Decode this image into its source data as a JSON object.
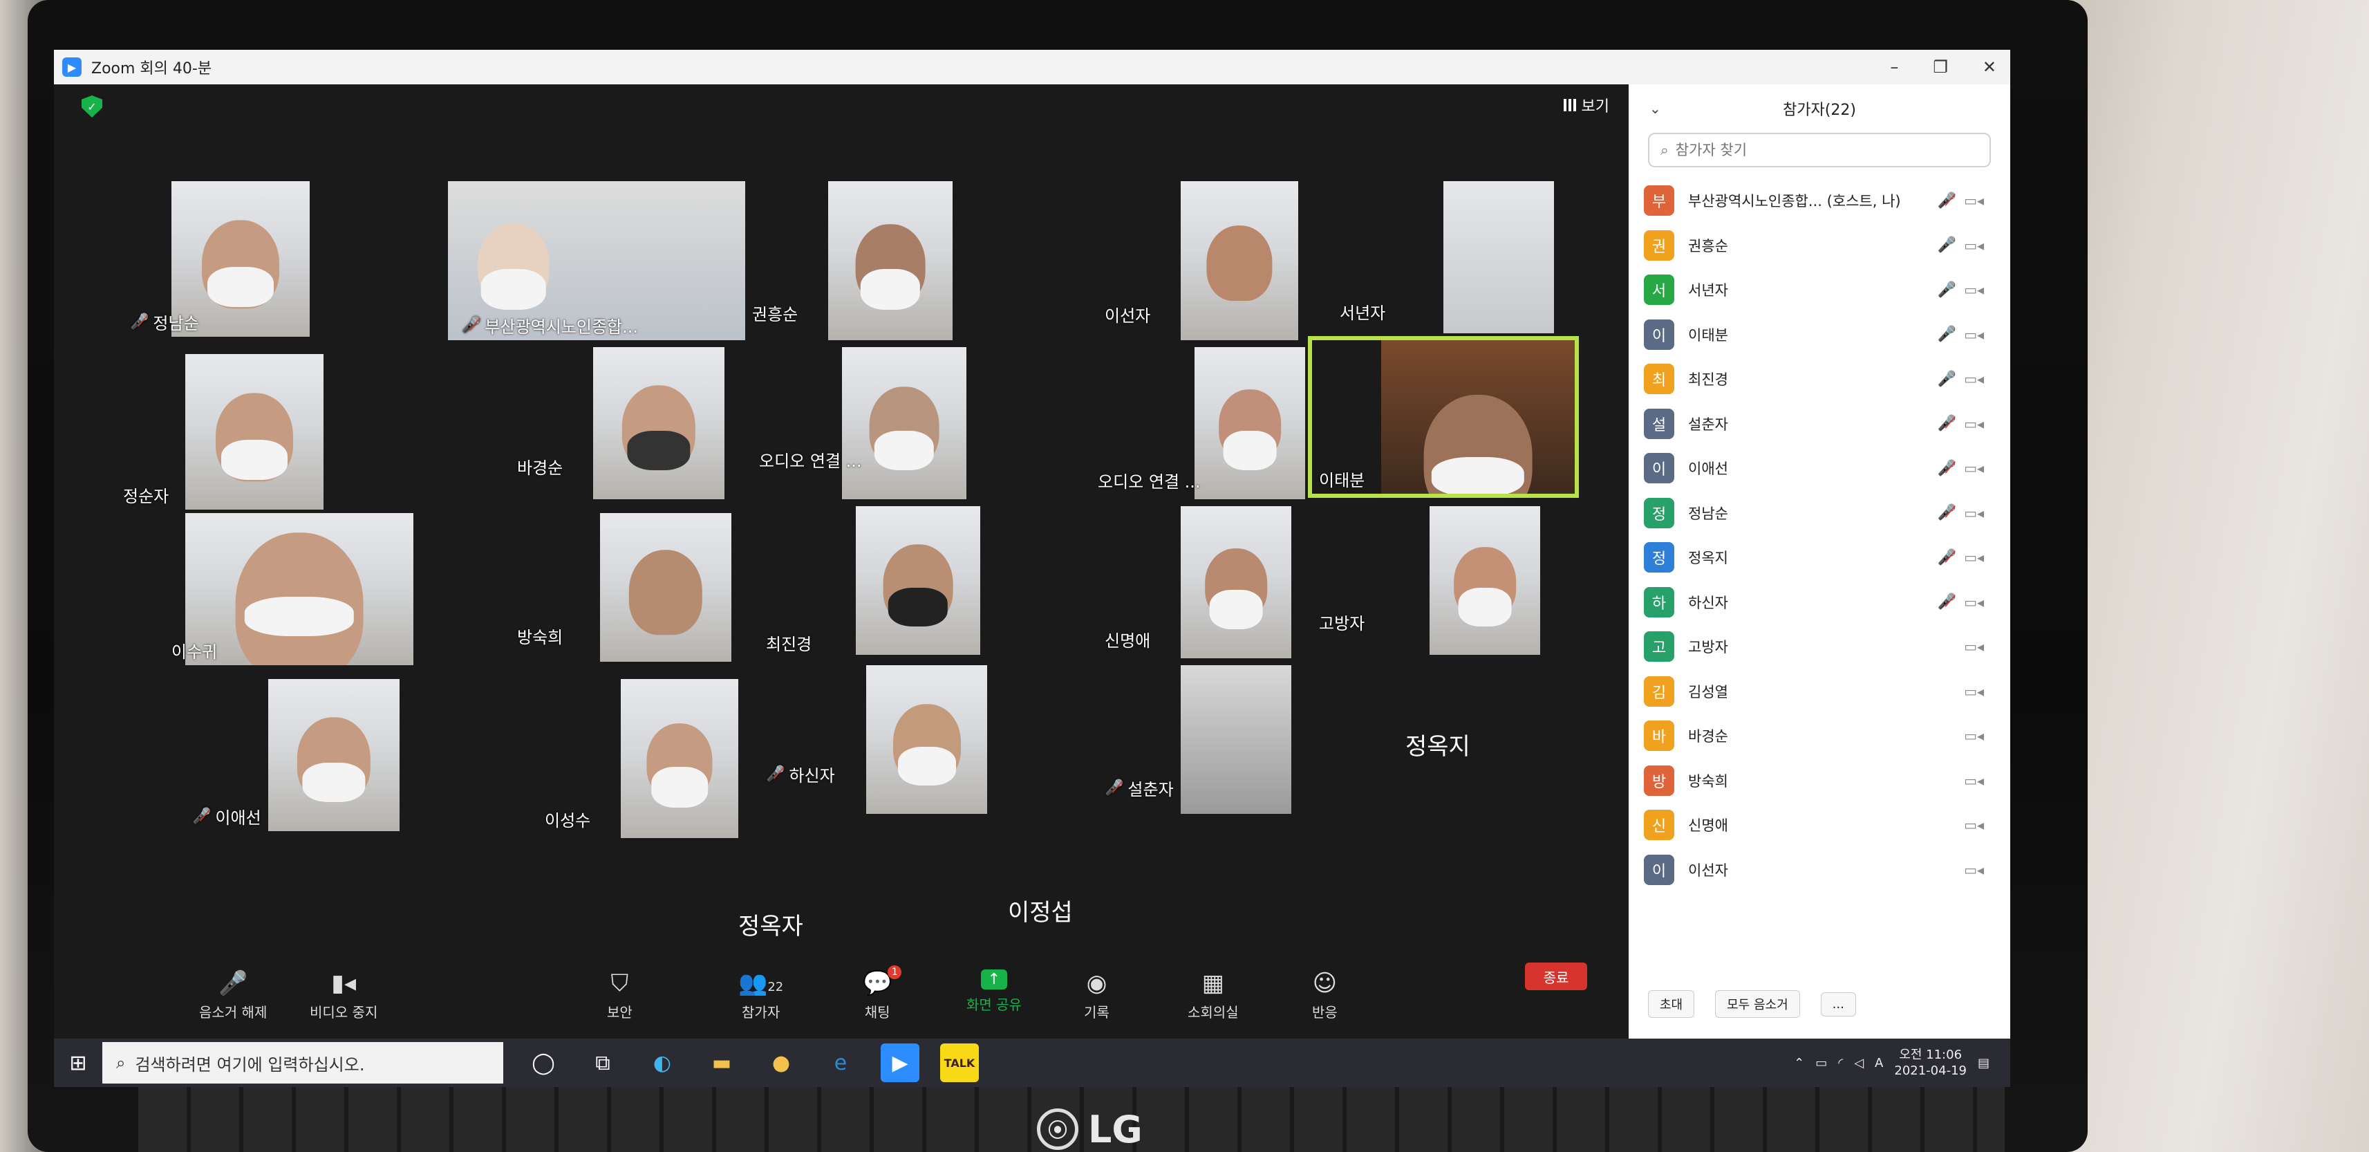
{
  "window": {
    "title": "Zoom 회의 40-분",
    "controls": [
      "–",
      "❐",
      "✕"
    ]
  },
  "meeting": {
    "view_label": "보기",
    "tiles": [
      {
        "name": "정남순",
        "muted": true
      },
      {
        "name": "부산광역시노인종합...",
        "muted": true
      },
      {
        "name": "권흥순",
        "muted": false
      },
      {
        "name": "이선자",
        "muted": false
      },
      {
        "name": "서년자",
        "muted": false
      },
      {
        "name": "정순자",
        "muted": false
      },
      {
        "name": "바경순",
        "muted": false
      },
      {
        "name": "오디오 연결 ...",
        "muted": false
      },
      {
        "name": "오디오 연결 ...",
        "muted": false
      },
      {
        "name": "이태분",
        "muted": false
      },
      {
        "name": "이수귀",
        "muted": false
      },
      {
        "name": "방숙희",
        "muted": false
      },
      {
        "name": "최진경",
        "muted": false
      },
      {
        "name": "신명애",
        "muted": false
      },
      {
        "name": "고방자",
        "muted": false
      },
      {
        "name": "이애선",
        "muted": true
      },
      {
        "name": "이성수",
        "muted": false
      },
      {
        "name": "하신자",
        "muted": true
      },
      {
        "name": "설춘자",
        "muted": true
      }
    ],
    "name_only": [
      "정옥지",
      "정옥자",
      "이정섭"
    ]
  },
  "toolbar": {
    "mute": "음소거 해제",
    "video": "비디오 중지",
    "security": "보안",
    "participants": "참가자",
    "participants_count": "22",
    "chat": "채팅",
    "chat_badge": "1",
    "share": "화면 공유",
    "record": "기록",
    "breakout": "소회의실",
    "reactions": "반응",
    "end": "종료"
  },
  "panel": {
    "title": "참가자(22)",
    "search_placeholder": "참가자 찾기",
    "participants": [
      {
        "initial": "부",
        "name": "부산광역시노인종합... (호스트, 나)",
        "color": "#e0643a",
        "mic": "muted"
      },
      {
        "initial": "권",
        "name": "권흥순",
        "color": "#f0a21f",
        "mic": "on"
      },
      {
        "initial": "서",
        "name": "서년자",
        "color": "#28a745",
        "mic": "on"
      },
      {
        "initial": "이",
        "name": "이태분",
        "color": "#5b6b85",
        "mic": "on"
      },
      {
        "initial": "최",
        "name": "최진경",
        "color": "#f0a21f",
        "mic": "on"
      },
      {
        "initial": "설",
        "name": "설춘자",
        "color": "#5b6b85",
        "mic": "muted"
      },
      {
        "initial": "이",
        "name": "이애선",
        "color": "#5b6b85",
        "mic": "muted"
      },
      {
        "initial": "정",
        "name": "정남순",
        "color": "#28a06a",
        "mic": "muted"
      },
      {
        "initial": "정",
        "name": "정옥지",
        "color": "#2d7fd8",
        "mic": "muted"
      },
      {
        "initial": "하",
        "name": "하신자",
        "color": "#28a06a",
        "mic": "muted"
      },
      {
        "initial": "고",
        "name": "고방자",
        "color": "#28a06a",
        "mic": "none"
      },
      {
        "initial": "김",
        "name": "김성열",
        "color": "#f0a21f",
        "mic": "none"
      },
      {
        "initial": "바",
        "name": "바경순",
        "color": "#f0a21f",
        "mic": "none"
      },
      {
        "initial": "방",
        "name": "방숙희",
        "color": "#e0643a",
        "mic": "none"
      },
      {
        "initial": "신",
        "name": "신명애",
        "color": "#f0a21f",
        "mic": "none"
      },
      {
        "initial": "이",
        "name": "이선자",
        "color": "#5b6b85",
        "mic": "none"
      }
    ],
    "footer": {
      "invite": "초대",
      "mute_all": "모두 음소거",
      "more": "..."
    }
  },
  "taskbar": {
    "search_placeholder": "검색하려면 여기에 입력하십시오.",
    "kakao": "TALK",
    "time": "오전 11:06",
    "date": "2021-04-19",
    "ime": "A"
  },
  "brand": {
    "laptop": "LG"
  }
}
